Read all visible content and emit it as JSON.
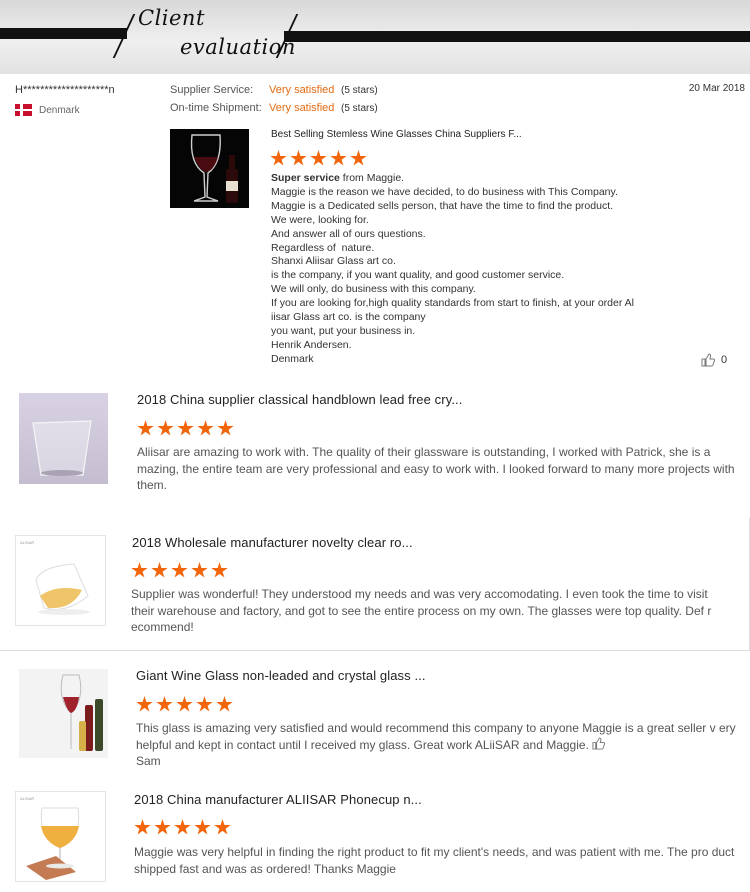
{
  "banner": {
    "line1": "Client",
    "line2": "evaluation"
  },
  "featured": {
    "user": "H********************n",
    "country": "Denmark",
    "supplier_service_label": "Supplier Service:",
    "supplier_service_value": "Very satisfied",
    "supplier_service_stars": "(5 stars)",
    "shipment_label": "On-time Shipment:",
    "shipment_value": "Very satisfied",
    "shipment_stars": "(5 stars)",
    "date": "20 Mar 2018",
    "product_title": "Best Selling Stemless Wine Glasses China Suppliers F...",
    "rating": 5,
    "body_bold": "Super service",
    "body_first_rest": " from Maggie.",
    "body_lines": [
      "Maggie is the reason we have decided, to do business with This Company.",
      "Maggie is a Dedicated sells person, that have the time to find the product.",
      "We were, looking for.",
      "And answer all of ours questions.",
      "Regardless of  nature.",
      "Shanxi Aliisar Glass art co.",
      "is the company, if you want quality, and good customer service.",
      "We will only, do business with this company.",
      "If you are looking for,high quality standards from start to finish, at your order Al",
      "iisar Glass art co. is the company",
      "you want, put your business in.",
      "Henrik Andersen.",
      "Denmark"
    ],
    "likes": "0"
  },
  "reviews": [
    {
      "title": "2018 China supplier classical handblown lead free cry...",
      "rating": 5,
      "text": "Aliisar are amazing to work with. The quality of their glassware is outstanding, I worked with Patrick, she is a mazing, the entire team are very professional and easy to work with. I looked forward to many more projects with them."
    },
    {
      "title": "2018 Wholesale manufacturer novelty clear ro...",
      "rating": 5,
      "logo": "ALISAR",
      "text": "Supplier was wonderful! They understood my needs and was very accomodating. I even took the time to visit their warehouse and factory, and got to see the entire process on my own. The glasses were top quality. Def r ecommend!"
    },
    {
      "title": "Giant Wine Glass non-leaded and crystal glass ...",
      "rating": 5,
      "text": "This glass is amazing very satisfied and would recommend this company to anyone Maggie is a great seller v ery helpful and kept in contact until I received my glass. Great work ALiiSAR and Maggie.",
      "signoff": "Sam"
    },
    {
      "title": "2018 China manufacturer ALIISAR Phonecup n...",
      "rating": 5,
      "logo": "ALISAR",
      "text": "Maggie was very helpful in finding the right product to fit my client's needs, and was patient with me. The pro duct shipped fast and was as ordered! Thanks Maggie"
    }
  ],
  "colors": {
    "accent": "#e46a12",
    "star": "#f2650b"
  },
  "icons": {
    "like": "thumbs-up-icon",
    "flag": "denmark-flag-icon",
    "star": "star-icon"
  }
}
